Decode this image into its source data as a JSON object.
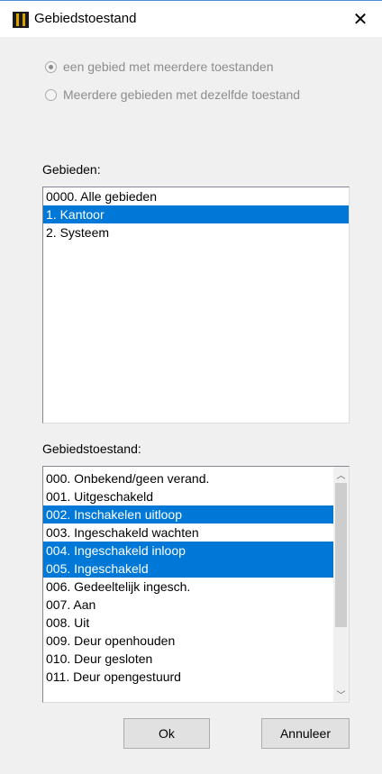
{
  "window": {
    "title": "Gebiedstoestand",
    "close_glyph": "✕",
    "app_icon": "app-icon"
  },
  "mode": {
    "options": [
      {
        "label": "een gebied met meerdere toestanden",
        "checked": true
      },
      {
        "label": "Meerdere gebieden met dezelfde toestand",
        "checked": false
      }
    ]
  },
  "areas": {
    "label": "Gebieden:",
    "items": [
      {
        "label": "0000. Alle gebieden",
        "selected": false
      },
      {
        "label": "1. Kantoor",
        "selected": true
      },
      {
        "label": "2. Systeem",
        "selected": false
      }
    ]
  },
  "states": {
    "label": "Gebiedstoestand:",
    "items": [
      {
        "label": "000. Onbekend/geen verand.",
        "selected": false
      },
      {
        "label": "001. Uitgeschakeld",
        "selected": false
      },
      {
        "label": "002. Inschakelen uitloop",
        "selected": true
      },
      {
        "label": "003. Ingeschakeld wachten",
        "selected": false
      },
      {
        "label": "004. Ingeschakeld inloop",
        "selected": true
      },
      {
        "label": "005. Ingeschakeld",
        "selected": true
      },
      {
        "label": "006. Gedeeltelijk ingesch.",
        "selected": false
      },
      {
        "label": "007. Aan",
        "selected": false
      },
      {
        "label": "008. Uit",
        "selected": false
      },
      {
        "label": "009. Deur openhouden",
        "selected": false
      },
      {
        "label": "010. Deur gesloten",
        "selected": false
      },
      {
        "label": "011. Deur opengestuurd",
        "selected": false
      }
    ],
    "scroll_up_glyph": "︿",
    "scroll_down_glyph": "﹀"
  },
  "buttons": {
    "ok": "Ok",
    "cancel": "Annuleer"
  },
  "colors": {
    "selection": "#0078d7",
    "disabled_text": "#8d8d8d"
  }
}
